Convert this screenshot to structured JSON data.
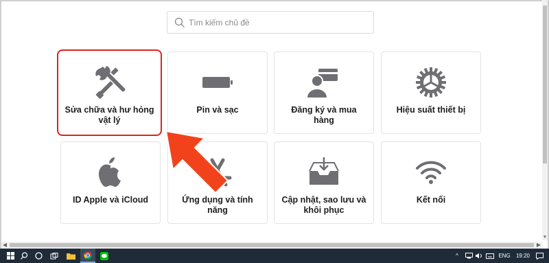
{
  "search": {
    "placeholder": "Tìm kiếm chủ đề"
  },
  "tiles": [
    {
      "label": "Sửa chữa và hư hỏng vật lý",
      "icon": "tools-icon"
    },
    {
      "label": "Pin và sạc",
      "icon": "battery-icon"
    },
    {
      "label": "Đăng ký và mua hàng",
      "icon": "user-card-icon"
    },
    {
      "label": "Hiệu suất thiết bị",
      "icon": "gear-icon"
    },
    {
      "label": "ID Apple và iCloud",
      "icon": "apple-logo-icon"
    },
    {
      "label": "Ứng dụng và tính năng",
      "icon": "app-store-icon"
    },
    {
      "label": "Cập nhật, sao lưu và khôi phục",
      "icon": "download-tray-icon"
    },
    {
      "label": "Kết nối",
      "icon": "wifi-icon"
    }
  ],
  "taskbar": {
    "language": "ENG",
    "time": "19:20"
  },
  "colors": {
    "highlight": "#d9251d",
    "arrow": "#f2421b",
    "icon": "#6e6e73",
    "taskbar": "#1f2b38"
  }
}
